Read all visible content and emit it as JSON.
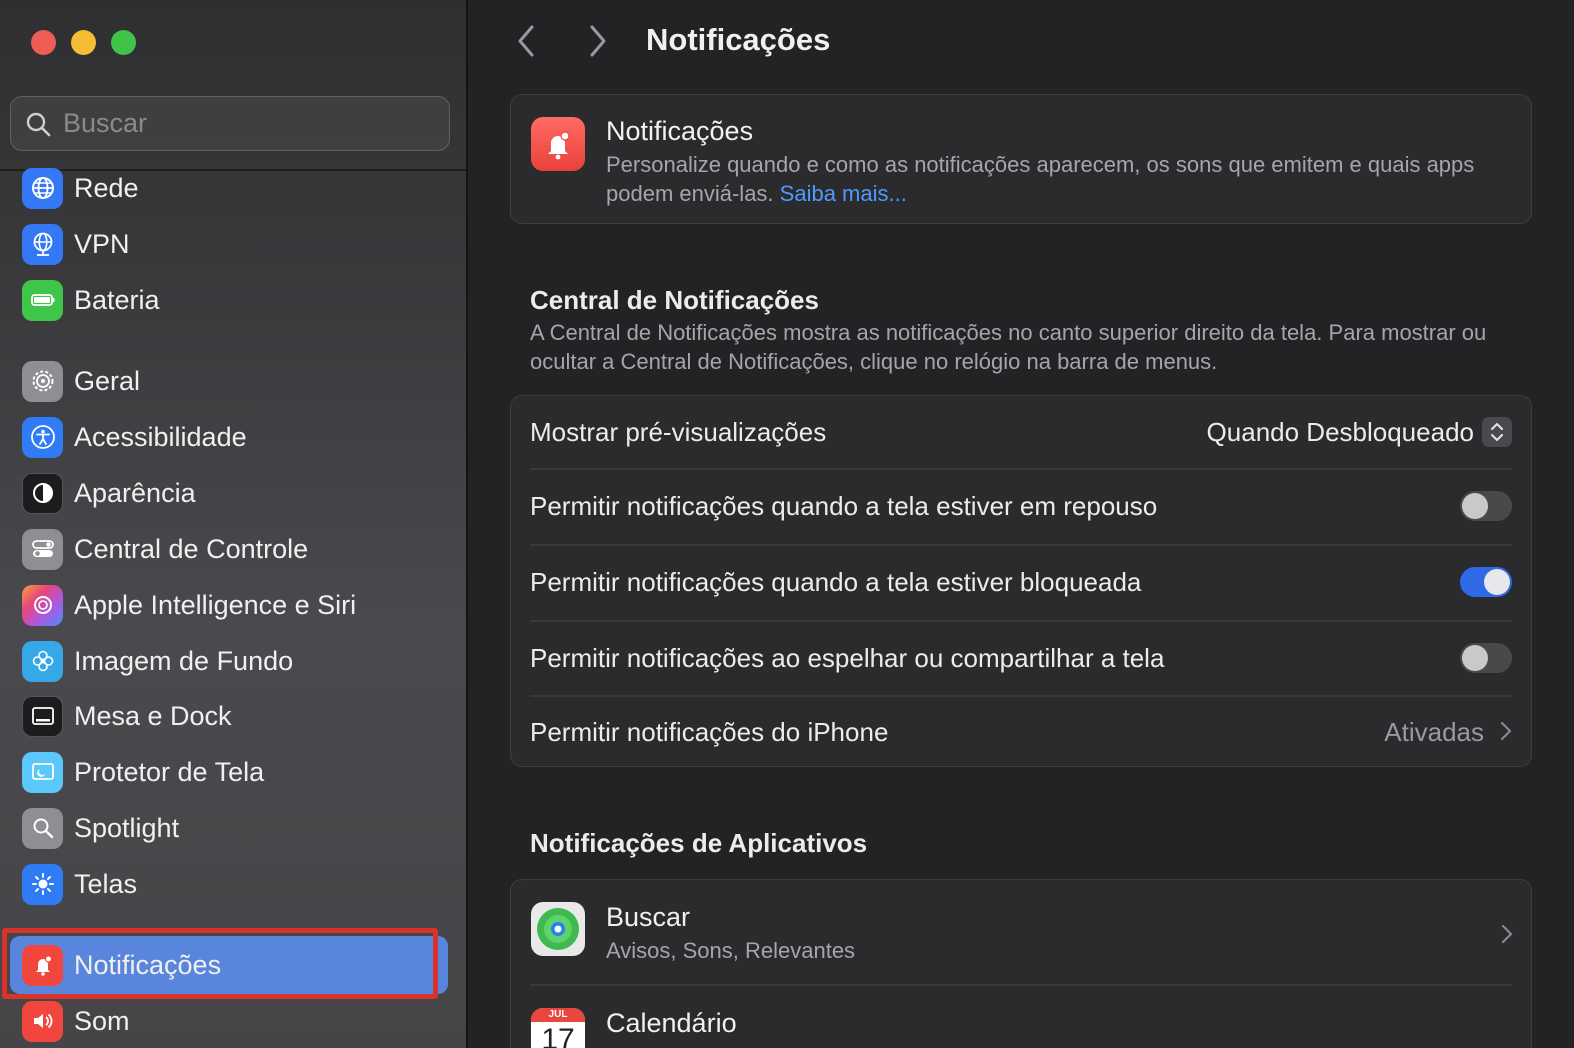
{
  "sidebar": {
    "search_placeholder": "Buscar",
    "items": [
      {
        "label": "Rede",
        "icon": "globe-icon",
        "color": "#3478f6"
      },
      {
        "label": "VPN",
        "icon": "vpn-globe-icon",
        "color": "#3478f6"
      },
      {
        "label": "Bateria",
        "icon": "battery-icon",
        "color": "#3ec54a"
      },
      {
        "label": "Geral",
        "icon": "gear-icon",
        "color": "#8e8e93"
      },
      {
        "label": "Acessibilidade",
        "icon": "accessibility-icon",
        "color": "#2f7cf6"
      },
      {
        "label": "Aparência",
        "icon": "appearance-icon",
        "color": "#1c1c1e"
      },
      {
        "label": "Central de Controle",
        "icon": "control-center-icon",
        "color": "#8e8e93"
      },
      {
        "label": "Apple Intelligence e Siri",
        "icon": "siri-icon",
        "color": "#c65ad9"
      },
      {
        "label": "Imagem de Fundo",
        "icon": "wallpaper-icon",
        "color": "#36a8e8"
      },
      {
        "label": "Mesa e Dock",
        "icon": "dock-icon",
        "color": "#1c1c1e"
      },
      {
        "label": "Protetor de Tela",
        "icon": "screensaver-icon",
        "color": "#5ac8fa"
      },
      {
        "label": "Spotlight",
        "icon": "spotlight-icon",
        "color": "#8e8e93"
      },
      {
        "label": "Telas",
        "icon": "displays-icon",
        "color": "#2f7cf6"
      },
      {
        "label": "Notificações",
        "icon": "notifications-icon",
        "color": "#f0463d",
        "selected": true
      },
      {
        "label": "Som",
        "icon": "sound-icon",
        "color": "#f0463d"
      }
    ]
  },
  "header": {
    "title": "Notificações"
  },
  "hero": {
    "title": "Notificações",
    "description": "Personalize quando e como as notificações aparecem, os sons que emitem e quais apps podem enviá-las.",
    "link": "Saiba mais..."
  },
  "central": {
    "title": "Central de Notificações",
    "description": "A Central de Notificações mostra as notificações no canto superior direito da tela. Para mostrar ou ocultar a Central de Notificações, clique no relógio na barra de menus.",
    "previews_label": "Mostrar pré-visualizações",
    "previews_value": "Quando Desbloqueado",
    "sleep_label": "Permitir notificações quando a tela estiver em repouso",
    "sleep_on": false,
    "locked_label": "Permitir notificações quando a tela estiver bloqueada",
    "locked_on": true,
    "mirror_label": "Permitir notificações ao espelhar ou compartilhar a tela",
    "mirror_on": false,
    "iphone_label": "Permitir notificações do iPhone",
    "iphone_value": "Ativadas"
  },
  "apps": {
    "title": "Notificações de Aplicativos",
    "items": [
      {
        "name": "Buscar",
        "detail": "Avisos, Sons, Relevantes",
        "icon": "find-my-icon"
      },
      {
        "name": "Calendário",
        "detail": "",
        "icon": "calendar-icon",
        "month": "JUL",
        "day": "17"
      }
    ]
  },
  "colors": {
    "accent": "#2e6ae6",
    "selection": "#5a85dc",
    "highlight_outline": "#d7332a",
    "link": "#4c9bff"
  }
}
